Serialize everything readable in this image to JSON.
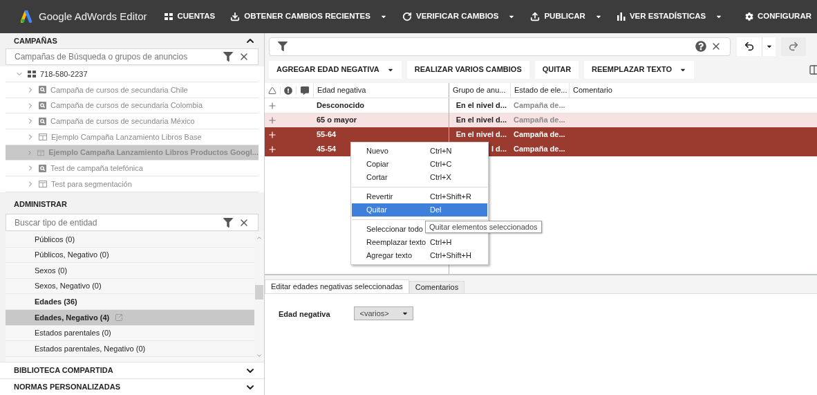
{
  "app": {
    "title": "Google AdWords Editor"
  },
  "nav": [
    {
      "kind": "accounts",
      "label": "CUENTAS",
      "dropdown": false
    },
    {
      "kind": "download",
      "label": "OBTENER CAMBIOS RECIENTES",
      "dropdown": true
    },
    {
      "kind": "refresh",
      "label": "VERIFICAR CAMBIOS",
      "dropdown": true
    },
    {
      "kind": "upload",
      "label": "PUBLICAR",
      "dropdown": true
    },
    {
      "kind": "stats",
      "label": "VER ESTADÍSTICAS",
      "dropdown": true
    }
  ],
  "settings_button": {
    "label": "CONFIGURAR"
  },
  "campaigns_panel": {
    "title": "CAMPAÑAS",
    "expanded": true,
    "search": {
      "placeholder": "Campañas de Búsqueda o grupos de anuncios"
    },
    "tree": [
      {
        "label": "718-580-2237",
        "kind": "account",
        "expanded": true,
        "selected": false,
        "children": [
          {
            "label": "Campaña de cursos de secundaria Chile",
            "kind": "search",
            "expanded": false,
            "selected": false
          },
          {
            "label": "Campaña de cursos de secundaria Colombia",
            "kind": "search",
            "expanded": false,
            "selected": false
          },
          {
            "label": "Campaña de cursos de secundaria México",
            "kind": "search",
            "expanded": false,
            "selected": false
          },
          {
            "label": "Ejemplo Campaña Lanzamiento Libros Base",
            "kind": "display",
            "expanded": false,
            "selected": false
          },
          {
            "label": "Ejemplo Campaña Lanzamiento Libros Productos Googl...",
            "kind": "display",
            "expanded": false,
            "selected": true
          },
          {
            "label": "Test de campaña telefónica",
            "kind": "search",
            "expanded": false,
            "selected": false
          },
          {
            "label": "Test para segmentación",
            "kind": "display",
            "expanded": false,
            "selected": false
          }
        ]
      }
    ]
  },
  "manage_panel": {
    "title": "ADMINISTRAR",
    "search": {
      "placeholder": "Buscar tipo de entidad"
    },
    "items": [
      {
        "label": "Públicos (0)",
        "has_items": false,
        "selected": false
      },
      {
        "label": "Públicos, Negativo (0)",
        "has_items": false,
        "selected": false
      },
      {
        "label": "Sexos (0)",
        "has_items": false,
        "selected": false
      },
      {
        "label": "Sexos, Negativo (0)",
        "has_items": false,
        "selected": false
      },
      {
        "label": "Edades (36)",
        "has_items": true,
        "selected": false
      },
      {
        "label": "Edades, Negativo (4)",
        "has_items": true,
        "selected": true
      },
      {
        "label": "Estados parentales (0)",
        "has_items": false,
        "selected": false
      },
      {
        "label": "Estados parentales, Negativo (0)",
        "has_items": false,
        "selected": false
      }
    ]
  },
  "collapsed_sections": [
    {
      "title": "BIBLIOTECA COMPARTIDA",
      "expanded": false
    },
    {
      "title": "NORMAS PERSONALIZADAS",
      "expanded": false
    }
  ],
  "toolbar": [
    {
      "label": "AGREGAR EDAD NEGATIVA",
      "dropdown": true
    },
    {
      "label": "REALIZAR VARIOS CAMBIOS",
      "dropdown": false
    },
    {
      "label": "QUITAR",
      "dropdown": false
    },
    {
      "label": "REEMPLAZAR TEXTO",
      "dropdown": true
    }
  ],
  "table": {
    "columns": [
      "Edad negativa",
      "Grupo de anu...",
      "Estado de ele...",
      "Comentario"
    ],
    "rows": [
      {
        "age": "Desconocido",
        "ad_group": "En el nivel d...",
        "status": "Campaña de...",
        "selected": false,
        "highlighted": false
      },
      {
        "age": "65 o mayor",
        "ad_group": "En el nivel d...",
        "status": "Campaña de...",
        "selected": false,
        "highlighted": true
      },
      {
        "age": "55-64",
        "ad_group": "En el nivel d...",
        "status": "Campaña de...",
        "selected": true,
        "highlighted": false
      },
      {
        "age": "45-54",
        "ad_group": "l d...",
        "status": "Campaña de...",
        "selected": true,
        "highlighted": false
      }
    ]
  },
  "context_menu": {
    "groups": [
      [
        {
          "label": "Nuevo",
          "shortcut": "Ctrl+N",
          "selected": false
        },
        {
          "label": "Copiar",
          "shortcut": "Ctrl+C",
          "selected": false
        },
        {
          "label": "Cortar",
          "shortcut": "Ctrl+X",
          "selected": false
        }
      ],
      [
        {
          "label": "Revertir",
          "shortcut": "Ctrl+Shift+R",
          "selected": false
        },
        {
          "label": "Quitar",
          "shortcut": "Del",
          "selected": true
        }
      ],
      [
        {
          "label": "Seleccionar todo",
          "selected": false
        },
        {
          "label": "Reemplazar texto",
          "shortcut": "Ctrl+H",
          "selected": false
        },
        {
          "label": "Agregar texto",
          "shortcut": "Ctrl+Shift+H",
          "selected": false
        }
      ]
    ]
  },
  "tooltip": "Quitar elementos seleccionados",
  "detail_tabs": [
    {
      "label": "Editar edades negativas seleccionadas",
      "selected": true
    },
    {
      "label": "Comentarios",
      "selected": false
    }
  ],
  "detail_form": {
    "label": "Edad negativa",
    "value": "<varios>"
  }
}
